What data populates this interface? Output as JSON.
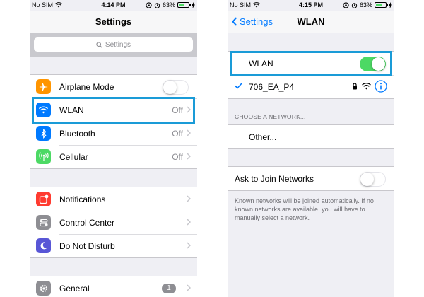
{
  "colors": {
    "accent": "#007aff",
    "highlight": "#1a9bd7",
    "toggle_on": "#4cd964",
    "airplane_icon": "#ff9500",
    "wlan_icon": "#007aff",
    "bluetooth_icon": "#007aff",
    "cellular_icon": "#4cd964",
    "notifications_icon": "#ff3b30",
    "control_center_icon": "#8e8e93",
    "dnd_icon": "#5856d6",
    "general_icon": "#8e8e93"
  },
  "left": {
    "status": {
      "carrier": "No SIM",
      "time": "4:14 PM",
      "battery": "63%",
      "battery_level": 0.63
    },
    "nav_title": "Settings",
    "search_placeholder": "Settings",
    "group1": [
      {
        "label": "Airplane Mode",
        "icon": "airplane-icon",
        "toggle": false
      },
      {
        "label": "WLAN",
        "icon": "wifi-icon",
        "value": "Off"
      },
      {
        "label": "Bluetooth",
        "icon": "bluetooth-icon",
        "value": "Off"
      },
      {
        "label": "Cellular",
        "icon": "cellular-icon",
        "value": "Off"
      }
    ],
    "group2": [
      {
        "label": "Notifications",
        "icon": "notifications-icon"
      },
      {
        "label": "Control Center",
        "icon": "control-center-icon"
      },
      {
        "label": "Do Not Disturb",
        "icon": "moon-icon"
      }
    ],
    "group3": [
      {
        "label": "General",
        "icon": "gear-icon",
        "badge": "1"
      }
    ]
  },
  "right": {
    "status": {
      "carrier": "No SIM",
      "time": "4:15 PM",
      "battery": "63%",
      "battery_level": 0.63
    },
    "nav_back": "Settings",
    "nav_title": "WLAN",
    "wlan_toggle_label": "WLAN",
    "wlan_on": true,
    "connected_network": "706_EA_P4",
    "choose_network_header": "CHOOSE A NETWORK...",
    "other_label": "Other...",
    "ask_to_join_label": "Ask to Join Networks",
    "ask_to_join_on": false,
    "footer": "Known networks will be joined automatically. If no known networks are available, you will have to manually select a network."
  }
}
